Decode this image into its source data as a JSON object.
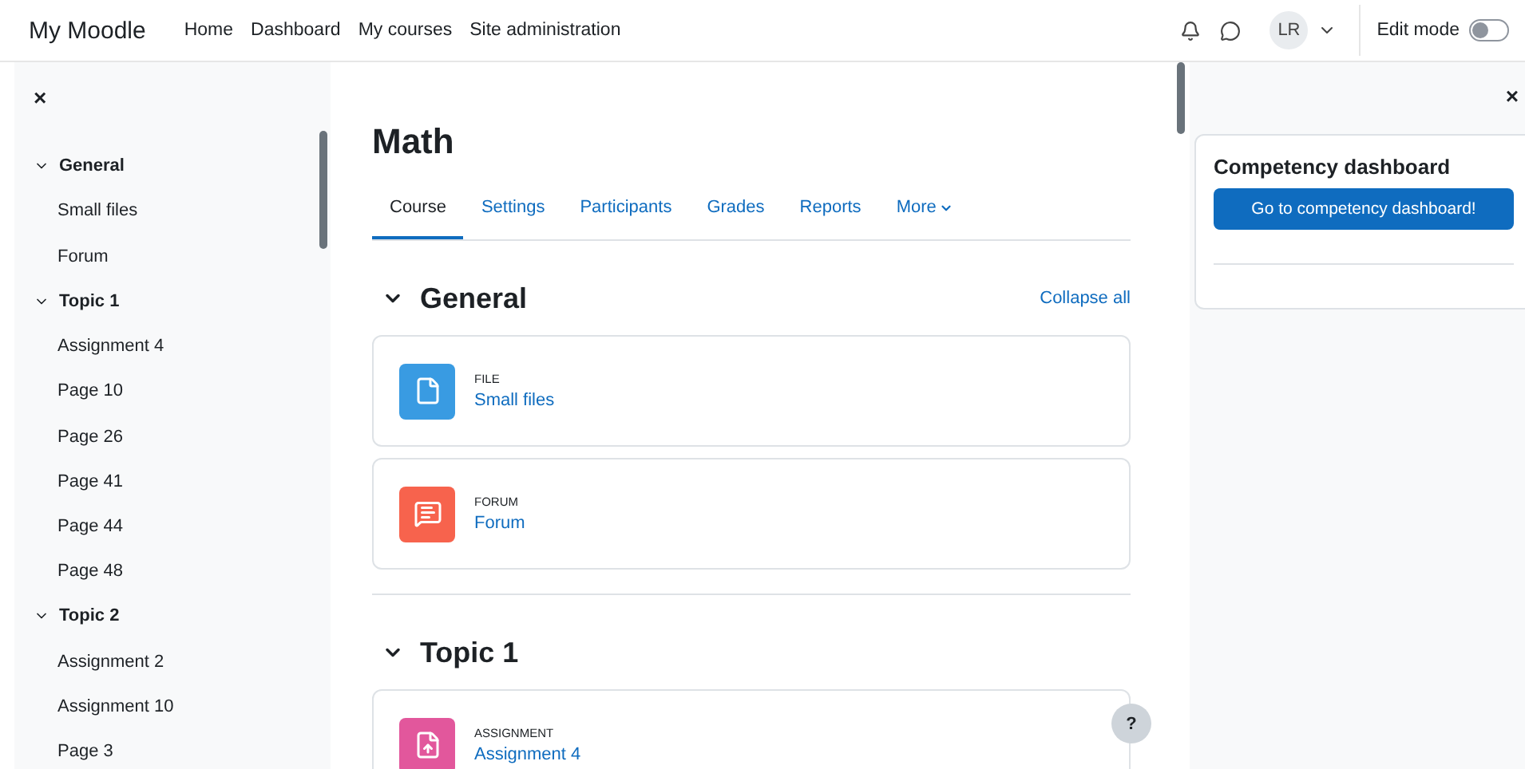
{
  "navbar": {
    "brand": "My Moodle",
    "links": [
      "Home",
      "Dashboard",
      "My courses",
      "Site administration"
    ],
    "avatar": "LR",
    "edit_mode": {
      "label": "Edit mode",
      "on": false
    }
  },
  "course_index": {
    "close": "×",
    "sections": [
      {
        "name": "General",
        "expanded": true,
        "items": [
          "Small files",
          "Forum"
        ]
      },
      {
        "name": "Topic 1",
        "expanded": true,
        "items": [
          "Assignment 4",
          "Page 10",
          "Page 26",
          "Page 41",
          "Page 44",
          "Page 48"
        ]
      },
      {
        "name": "Topic 2",
        "expanded": true,
        "items": [
          "Assignment 2",
          "Assignment 10",
          "Page 3"
        ]
      }
    ]
  },
  "course": {
    "title": "Math",
    "tabs": [
      {
        "label": "Course",
        "selected": true
      },
      {
        "label": "Settings",
        "selected": false
      },
      {
        "label": "Participants",
        "selected": false
      },
      {
        "label": "Grades",
        "selected": false
      },
      {
        "label": "Reports",
        "selected": false
      },
      {
        "label": "More",
        "selected": false
      }
    ],
    "collapse_all": "Collapse all",
    "sections": [
      {
        "name": "General",
        "expanded": true,
        "activities": [
          {
            "kind": "file",
            "type": "FILE",
            "name": "Small files"
          },
          {
            "kind": "forum",
            "type": "FORUM",
            "name": "Forum"
          }
        ]
      },
      {
        "name": "Topic 1",
        "expanded": true,
        "activities": [
          {
            "kind": "assign",
            "type": "ASSIGNMENT",
            "name": "Assignment 4"
          }
        ]
      }
    ]
  },
  "help": "?",
  "block_drawer": {
    "close": "×",
    "block": {
      "title": "Competency dashboard",
      "button": "Go to competency dashboard!"
    }
  }
}
